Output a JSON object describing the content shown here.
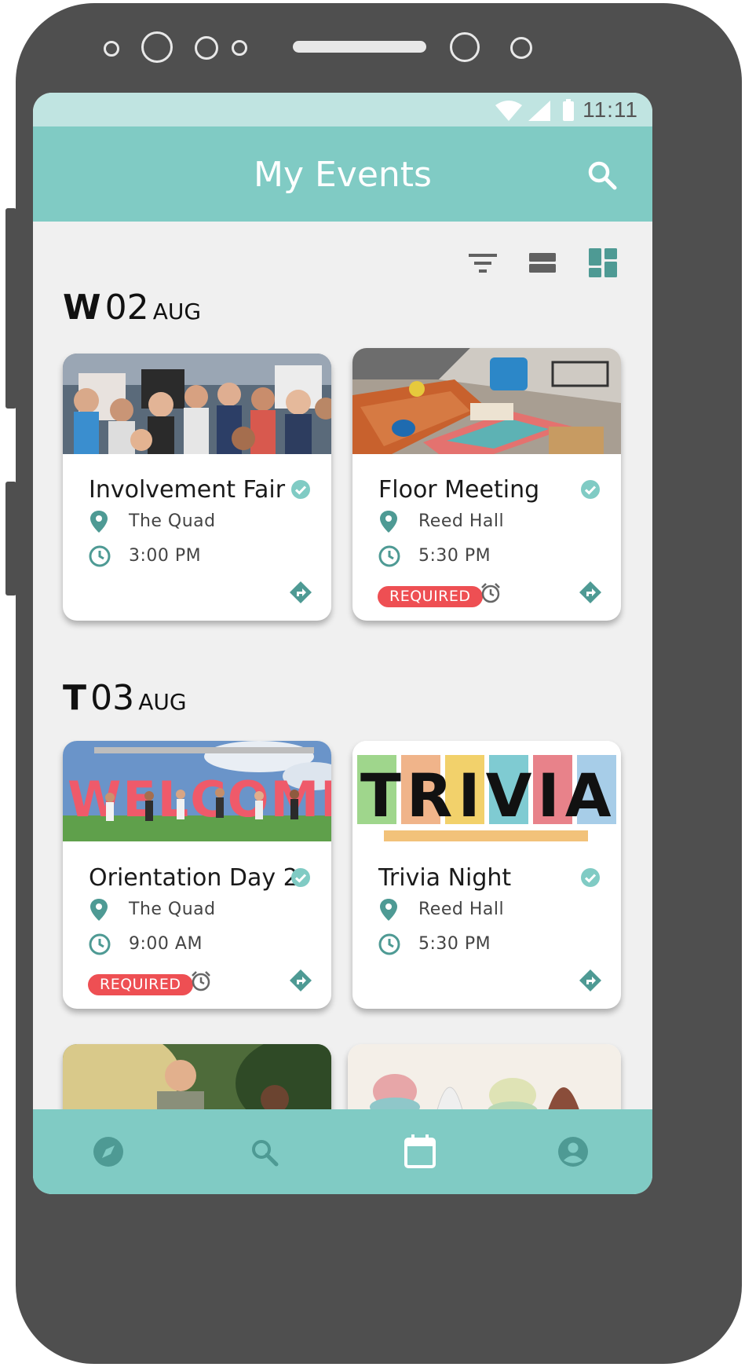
{
  "status_bar": {
    "time": "11:11"
  },
  "app_bar": {
    "title": "My Events",
    "search_icon": "search-icon"
  },
  "view_controls": {
    "icons": [
      "filter-icon",
      "list-view-icon",
      "grid-view-icon"
    ],
    "active": "grid-view-icon"
  },
  "days": [
    {
      "weekday": "W",
      "day": "02",
      "month": "AUG",
      "events": [
        {
          "title": "Involvement Fair",
          "location": "The Quad",
          "time": "3:00 PM",
          "required": false,
          "checked": true
        },
        {
          "title": "Floor Meeting",
          "location": "Reed Hall",
          "time": "5:30 PM",
          "required": true,
          "required_label": "REQUIRED",
          "checked": true
        }
      ]
    },
    {
      "weekday": "T",
      "day": "03",
      "month": "AUG",
      "events": [
        {
          "title": "Orientation Day 2",
          "location": "The Quad",
          "time": "9:00 AM",
          "required": true,
          "required_label": "REQUIRED",
          "checked": true
        },
        {
          "title": "Trivia Night",
          "location": "Reed Hall",
          "time": "5:30 PM",
          "required": false,
          "checked": true
        }
      ]
    }
  ],
  "trivia_image_text": "TRIVIA",
  "welcome_image_text": "WELCOME",
  "bottom_nav": {
    "items": [
      "explore-icon",
      "search-icon",
      "calendar-icon",
      "account-icon"
    ],
    "active": "calendar-icon"
  },
  "colors": {
    "primary": "#80cbc4",
    "primary_dark": "#4e9a94",
    "status_bar": "#c0e4e1",
    "required": "#ee4f53",
    "background": "#f0f0f0",
    "frame": "#4f4f4f"
  }
}
